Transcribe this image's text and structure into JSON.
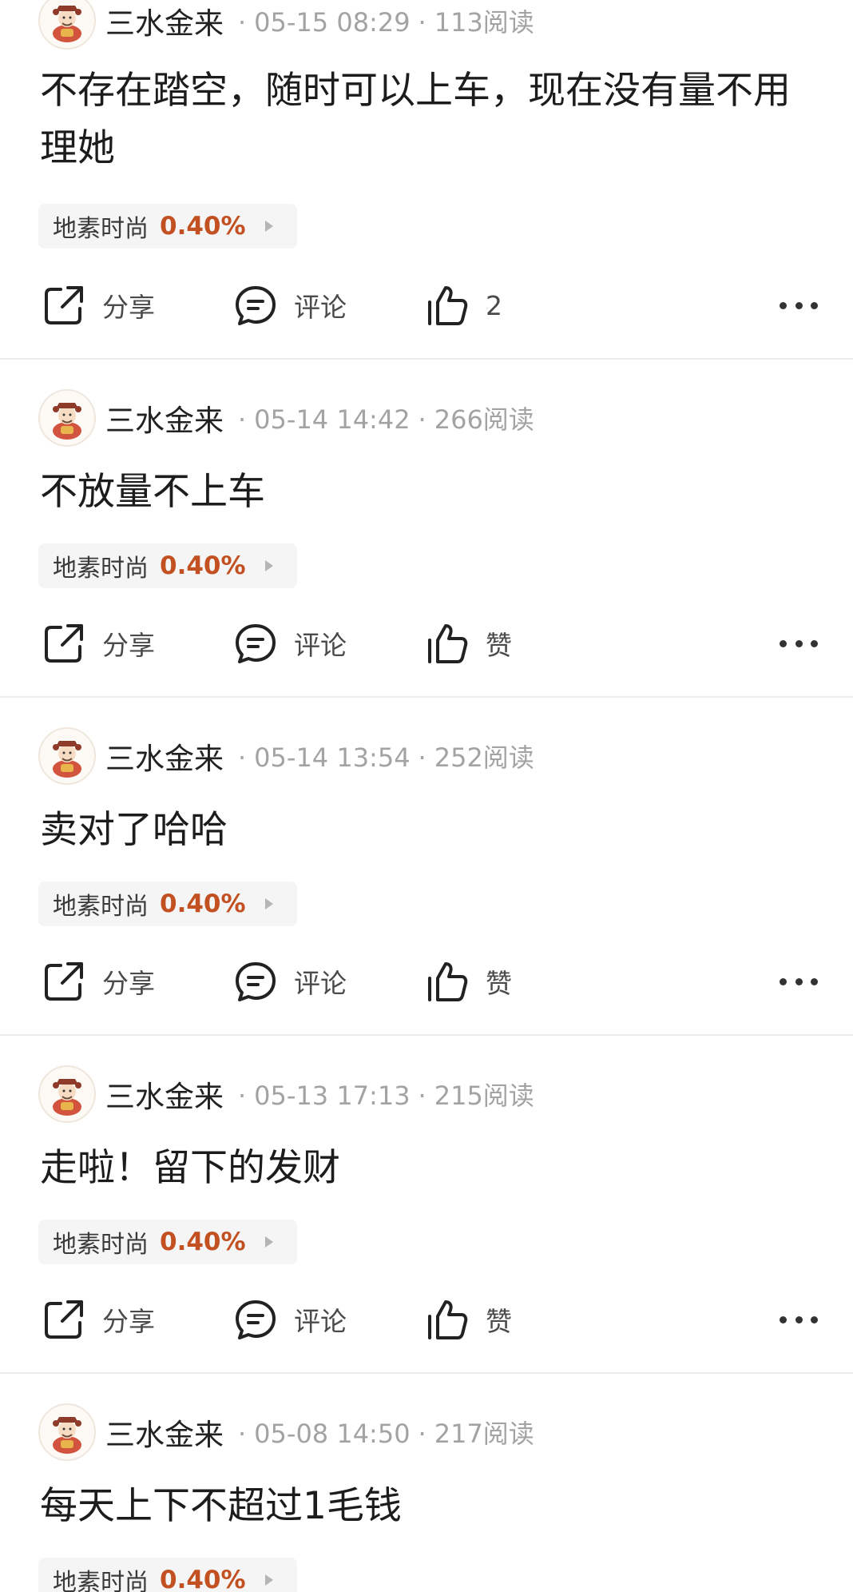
{
  "posts": [
    {
      "author": "三水金来",
      "time": "05-15 08:29",
      "reads": "113阅读",
      "text": "不存在踏空，随时可以上车，现在没有量不用理她",
      "stock": {
        "name": "地素时尚",
        "change": "0.40%"
      },
      "actions": {
        "share": "分享",
        "comment": "评论",
        "like": "2"
      }
    },
    {
      "author": "三水金来",
      "time": "05-14 14:42",
      "reads": "266阅读",
      "text": "不放量不上车",
      "stock": {
        "name": "地素时尚",
        "change": "0.40%"
      },
      "actions": {
        "share": "分享",
        "comment": "评论",
        "like": "赞"
      }
    },
    {
      "author": "三水金来",
      "time": "05-14 13:54",
      "reads": "252阅读",
      "text": "卖对了哈哈",
      "stock": {
        "name": "地素时尚",
        "change": "0.40%"
      },
      "actions": {
        "share": "分享",
        "comment": "评论",
        "like": "赞"
      }
    },
    {
      "author": "三水金来",
      "time": "05-13 17:13",
      "reads": "215阅读",
      "text": "走啦！留下的发财",
      "stock": {
        "name": "地素时尚",
        "change": "0.40%"
      },
      "actions": {
        "share": "分享",
        "comment": "评论",
        "like": "赞"
      }
    },
    {
      "author": "三水金来",
      "time": "05-08 14:50",
      "reads": "217阅读",
      "text": "每天上下不超过1毛钱",
      "stock": {
        "name": "地素时尚",
        "change": "0.40%"
      }
    }
  ],
  "colors": {
    "stock_change": "#c25020",
    "meta_text": "#a3a3a3",
    "divider": "#ececec",
    "tag_background": "#f5f5f6"
  },
  "icons": {
    "share": "share-icon",
    "comment": "comment-icon",
    "like": "thumbs-up-icon",
    "more": "more-icon",
    "avatar": "god-of-wealth-avatar"
  }
}
